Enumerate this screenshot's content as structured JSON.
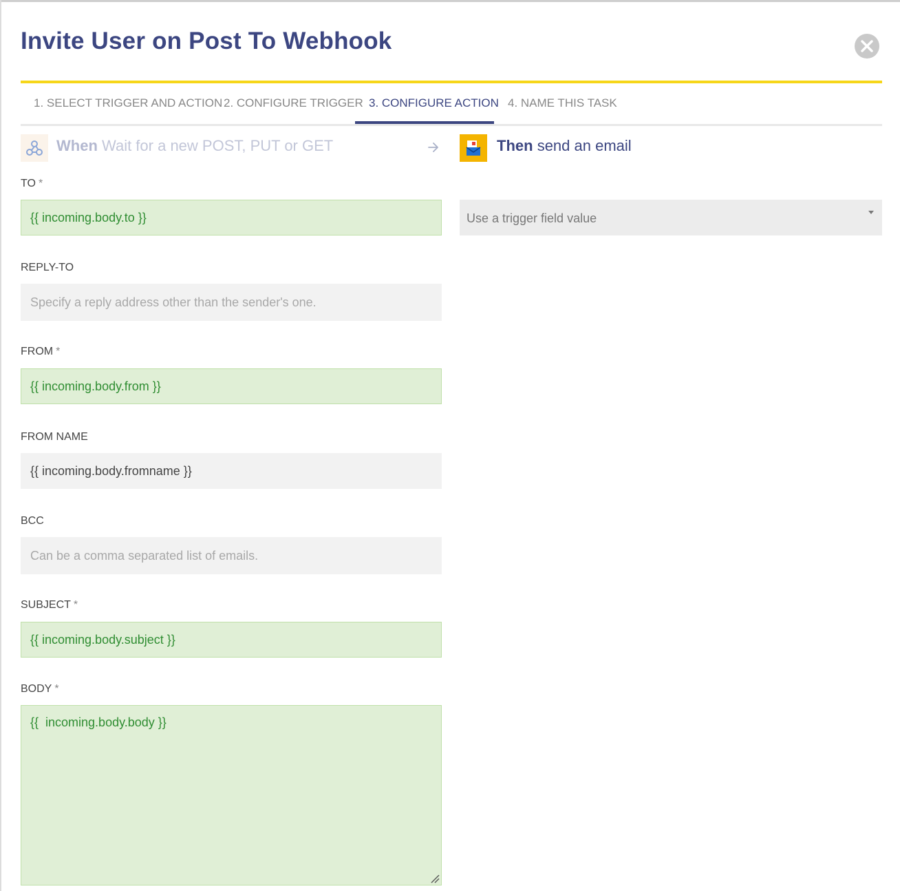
{
  "dialog": {
    "title": "Invite User on Post To Webhook"
  },
  "tabs": [
    {
      "label": "1. SELECT TRIGGER AND ACTION",
      "active": false
    },
    {
      "label": "2. CONFIGURE TRIGGER",
      "active": false
    },
    {
      "label": "3. CONFIGURE ACTION",
      "active": true
    },
    {
      "label": "4. NAME THIS TASK",
      "active": false
    }
  ],
  "flow": {
    "trigger_keyword": "When",
    "trigger_text": "Wait for a new POST, PUT or GET",
    "trigger_icon": "webhook-icon",
    "action_keyword": "Then",
    "action_text": "send an email",
    "action_icon": "email-icon"
  },
  "fields": {
    "to": {
      "label": "TO",
      "required": "*",
      "value": "{{ incoming.body.to }}"
    },
    "reply_to": {
      "label": "REPLY-TO",
      "placeholder": "Specify a reply address other than the sender's one."
    },
    "from": {
      "label": "FROM",
      "required": "*",
      "value": "{{ incoming.body.from }}"
    },
    "from_name": {
      "label": "FROM NAME",
      "value": "{{ incoming.body.fromname }}"
    },
    "bcc": {
      "label": "BCC",
      "placeholder": "Can be a comma separated list of emails."
    },
    "subject": {
      "label": "SUBJECT",
      "required": "*",
      "value": "{{ incoming.body.subject }}"
    },
    "body": {
      "label": "BODY",
      "required": "*",
      "value": "{{  incoming.body.body }}"
    }
  },
  "to_source_select": {
    "selected": "Use a trigger field value"
  },
  "colors": {
    "brand": "#3c4681",
    "accent_yellow": "#f6d619",
    "field_green_bg": "#e0efd6",
    "field_green_text": "#2f8d32"
  }
}
